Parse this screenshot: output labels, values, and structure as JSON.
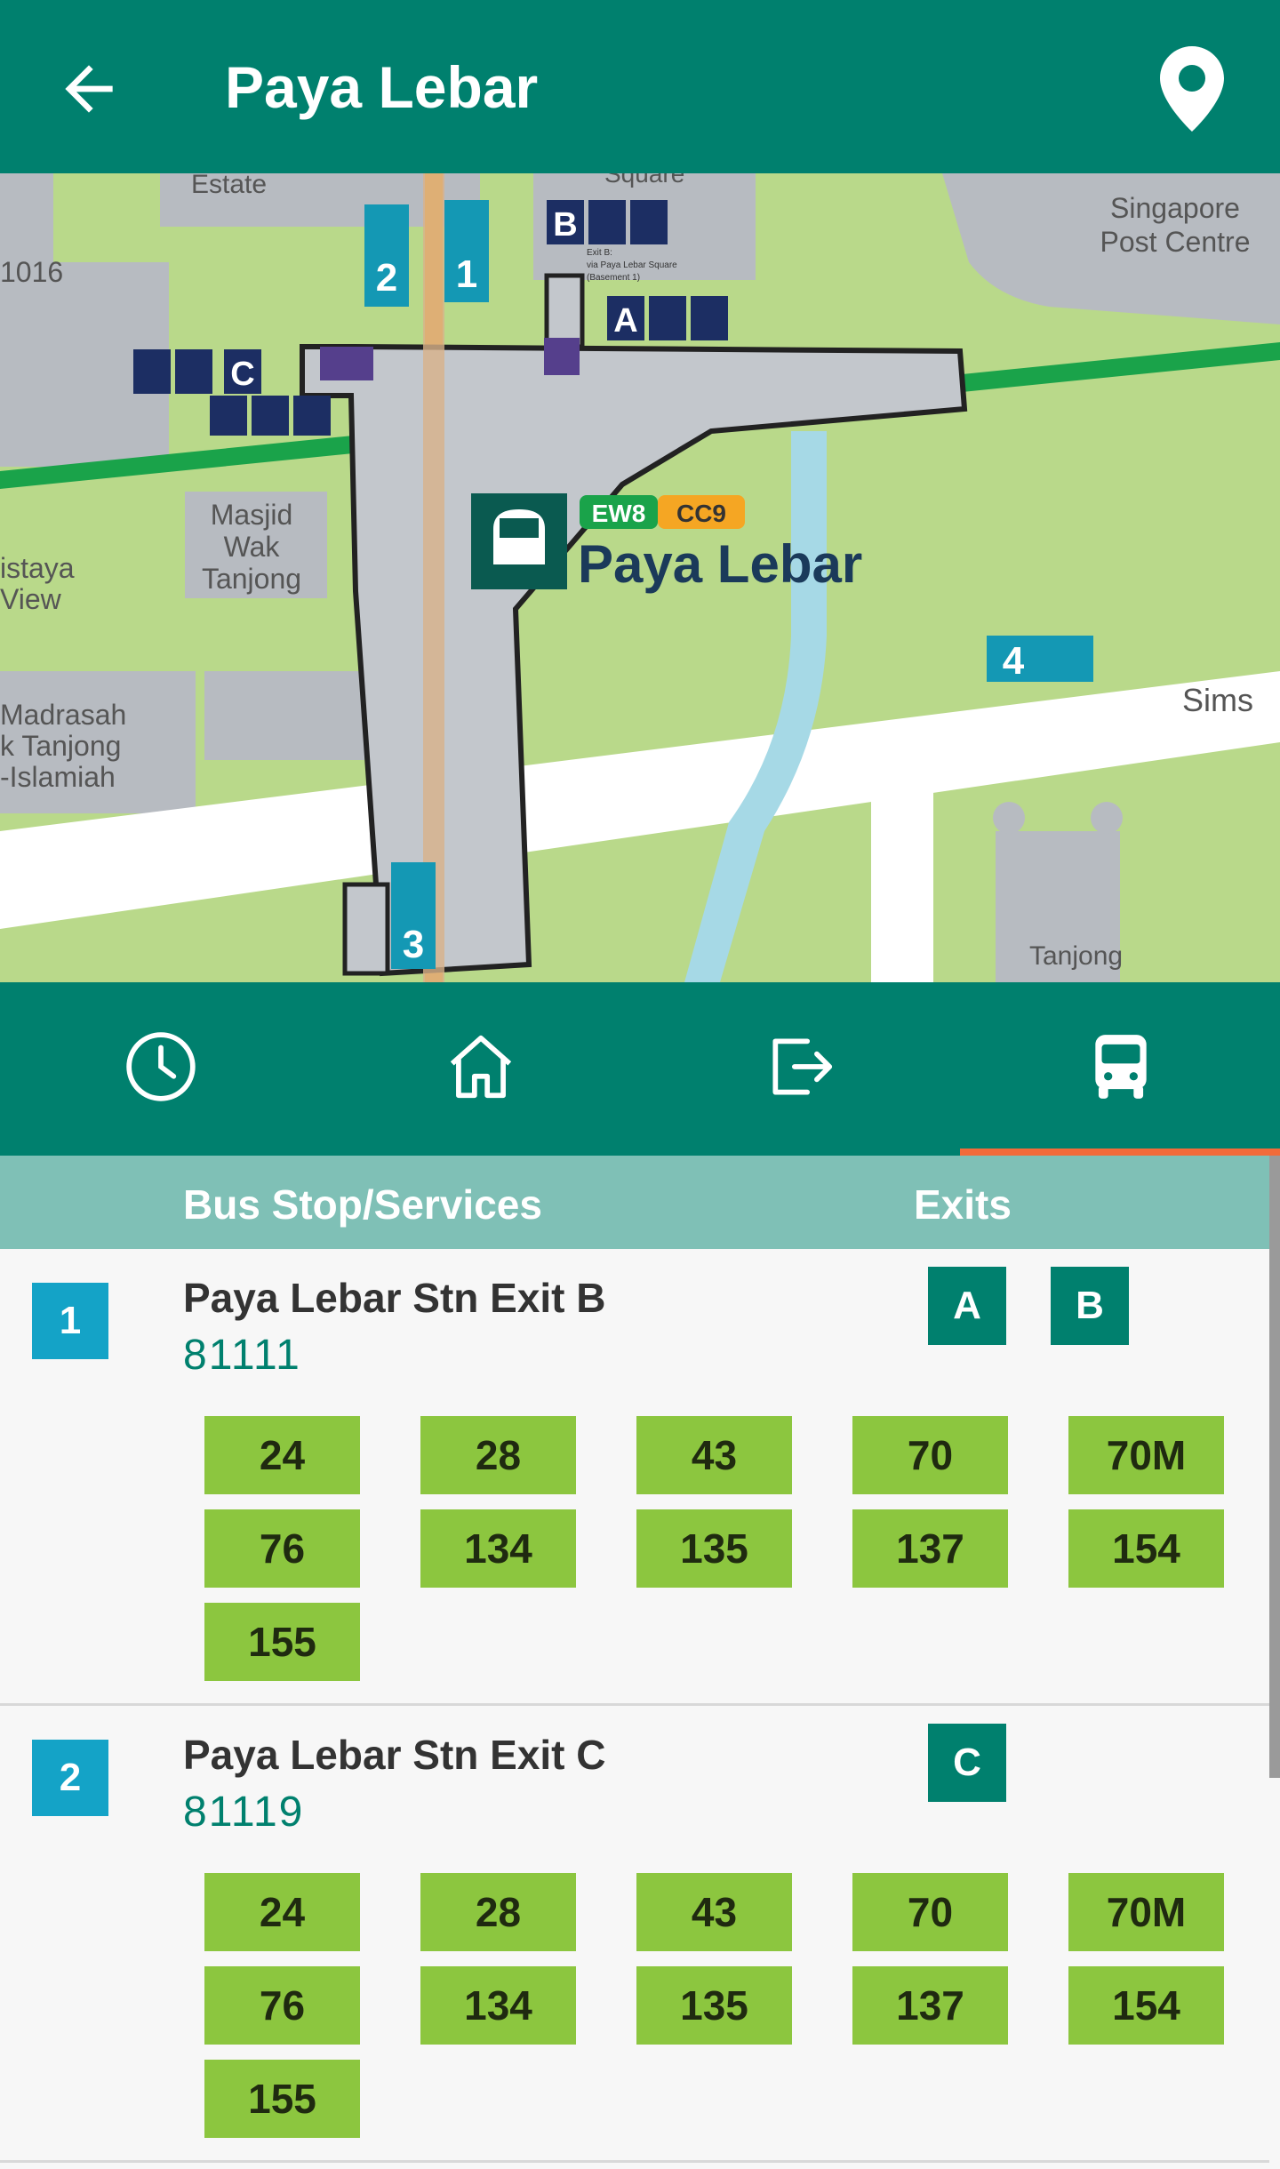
{
  "app_bar": {
    "title": "Paya Lebar",
    "back_icon": "arrow-left-icon",
    "location_icon": "map-pin-icon"
  },
  "map": {
    "station_name": "Paya Lebar",
    "station_codes": [
      "EW8",
      "CC9"
    ],
    "labels": {
      "estate": "Estate",
      "square": "Square",
      "post_centre_1": "Singapore",
      "post_centre_2": "Post Centre",
      "code_1016": "1016",
      "masjid_1": "Masjid",
      "masjid_2": "Wak",
      "masjid_3": "Tanjong",
      "view_1": "istaya",
      "view_2": "View",
      "madrasah_1": "Madrasah",
      "madrasah_2": "k Tanjong",
      "madrasah_3": "-Islamiah",
      "sims": "Sims",
      "tanjong": "Tanjong",
      "exit_b_note_1": "Exit B:",
      "exit_b_note_2": "via Paya Lebar Square",
      "exit_b_note_3": "(Basement 1)",
      "bus_1": "1",
      "bus_2": "2",
      "bus_3": "3",
      "bus_4": "4",
      "exit_a": "A",
      "exit_b": "B",
      "exit_c": "C"
    },
    "colors": {
      "ew_line": "#1aa34a",
      "cc_line": "#f5a623"
    }
  },
  "tabs": [
    {
      "name": "clock-icon",
      "selected": false
    },
    {
      "name": "home-icon",
      "selected": false
    },
    {
      "name": "exit-icon",
      "selected": false
    },
    {
      "name": "bus-icon",
      "selected": true
    }
  ],
  "table_header": {
    "stop_col": "Bus Stop/Services",
    "exits_col": "Exits"
  },
  "stops": [
    {
      "index": "1",
      "name": "Paya Lebar Stn Exit B",
      "code": "81111",
      "exits": [
        "A",
        "B"
      ],
      "services": [
        "24",
        "28",
        "43",
        "70",
        "70M",
        "76",
        "134",
        "135",
        "137",
        "154",
        "155"
      ]
    },
    {
      "index": "2",
      "name": "Paya Lebar Stn Exit C",
      "code": "81119",
      "exits": [
        "C"
      ],
      "services": [
        "24",
        "28",
        "43",
        "70",
        "70M",
        "76",
        "134",
        "135",
        "137",
        "154",
        "155"
      ]
    }
  ]
}
